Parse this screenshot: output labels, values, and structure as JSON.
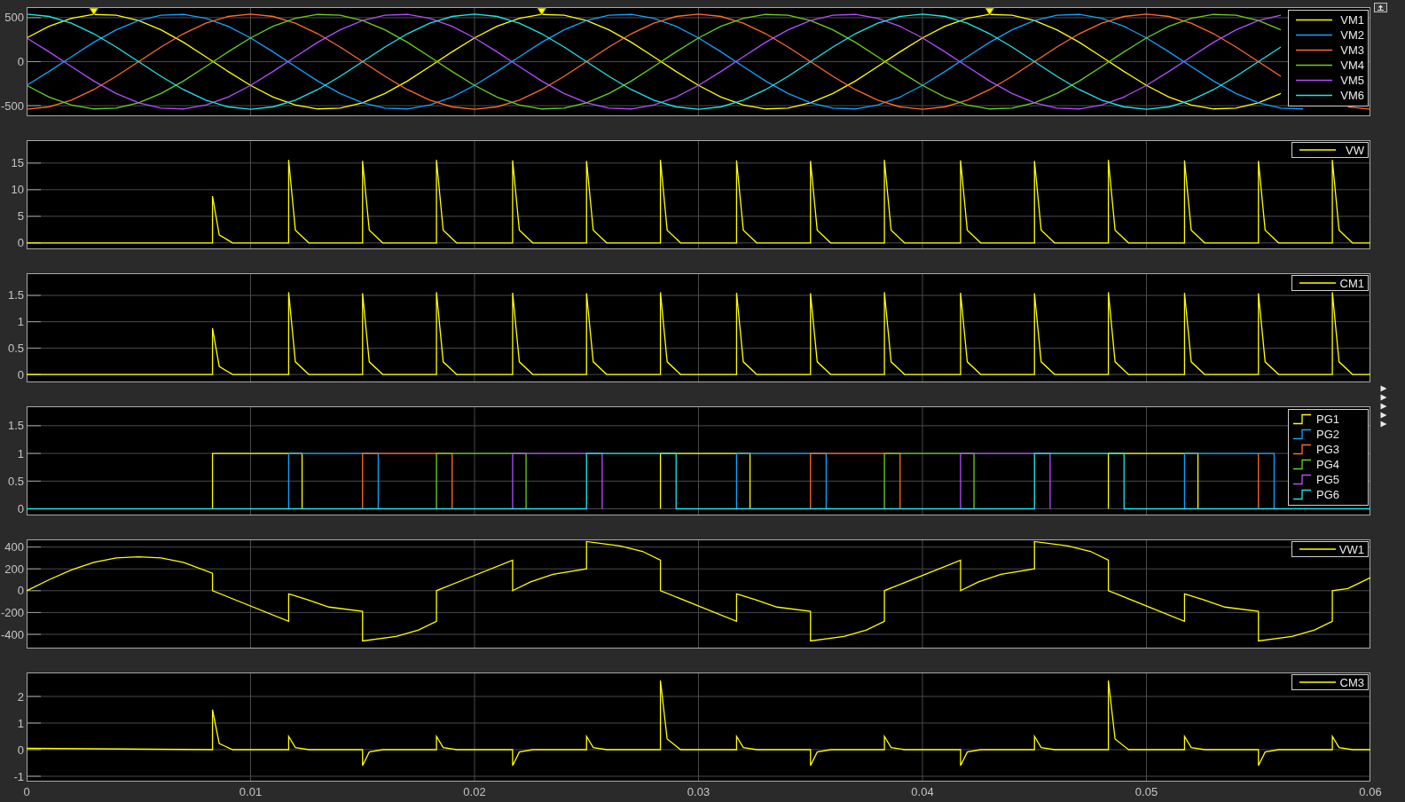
{
  "scopes": [
    {
      "peak_finder": true,
      "chart_data": {
        "type": "line",
        "grid": true,
        "legend": true,
        "xlim": [
          0,
          0.06
        ],
        "ylim": [
          -620,
          620
        ],
        "yticks": [
          -500,
          0,
          500
        ],
        "x": [
          0,
          0.001,
          0.002,
          0.003,
          0.004,
          0.005,
          0.006,
          0.007,
          0.008,
          0.009,
          0.01,
          0.011,
          0.012,
          0.013,
          0.014,
          0.015,
          0.016,
          0.017,
          0.018,
          0.019,
          0.02,
          0.021,
          0.022,
          0.023,
          0.024,
          0.025,
          0.026,
          0.027,
          0.028,
          0.029,
          0.03,
          0.031,
          0.032,
          0.033,
          0.034,
          0.035,
          0.036,
          0.037,
          0.038,
          0.039,
          0.04,
          0.041,
          0.042,
          0.043,
          0.044,
          0.045,
          0.046,
          0.047,
          0.048,
          0.049,
          0.05,
          0.051,
          0.052,
          0.053,
          0.054,
          0.055,
          0.056,
          0.057,
          0.059,
          0.06
        ],
        "series": [
          {
            "name": "VM1",
            "color": "#ffff00",
            "values": [
              270,
              401,
              493,
              537,
              528,
              468,
              361,
              220,
              56,
              -112,
              -270,
              -401,
              -493,
              -537,
              -528,
              -468,
              -361,
              -220,
              -56,
              112,
              270,
              401,
              493,
              537,
              528,
              468,
              361,
              220,
              56,
              -112,
              -270,
              -401,
              -493,
              -537,
              -528,
              -468,
              -361,
              -220,
              -56,
              112,
              270,
              401,
              493,
              537,
              528,
              468,
              361,
              220,
              56,
              -112,
              -270,
              -401,
              -493,
              -537,
              -528,
              -468,
              -361,
              null,
              null,
              null
            ]
          },
          {
            "name": "VM2",
            "color": "#0fa3ff",
            "values": [
              -270,
              -112,
              56,
              220,
              361,
              468,
              528,
              537,
              493,
              401,
              270,
              112,
              -56,
              -220,
              -361,
              -468,
              -528,
              -537,
              -493,
              -401,
              -270,
              -112,
              56,
              220,
              361,
              468,
              528,
              537,
              493,
              401,
              270,
              112,
              -56,
              -220,
              -361,
              -468,
              -528,
              -537,
              -493,
              -401,
              -270,
              -112,
              56,
              220,
              361,
              468,
              528,
              537,
              493,
              401,
              270,
              112,
              -56,
              -220,
              -361,
              -468,
              -528,
              -537,
              null,
              null
            ]
          },
          {
            "name": "VM3",
            "color": "#ff6a2b",
            "values": [
              -540,
              -514,
              -437,
              -317,
              -167,
              0,
              167,
              317,
              437,
              514,
              540,
              514,
              437,
              317,
              167,
              0,
              -167,
              -317,
              -437,
              -514,
              -540,
              -514,
              -437,
              -317,
              -167,
              0,
              167,
              317,
              437,
              514,
              540,
              514,
              437,
              317,
              167,
              0,
              -167,
              -317,
              -437,
              -514,
              -540,
              -514,
              -437,
              -317,
              -167,
              0,
              167,
              317,
              437,
              514,
              540,
              514,
              437,
              317,
              167,
              0,
              -167,
              null,
              -514,
              -540
            ]
          },
          {
            "name": "VM4",
            "color": "#69d11a",
            "values": [
              -270,
              -401,
              -493,
              -537,
              -528,
              -468,
              -361,
              -220,
              -56,
              112,
              270,
              401,
              493,
              537,
              528,
              468,
              361,
              220,
              56,
              -112,
              -270,
              -401,
              -493,
              -537,
              -528,
              -468,
              -361,
              -220,
              -56,
              112,
              270,
              401,
              493,
              537,
              528,
              468,
              361,
              220,
              56,
              -112,
              -270,
              -401,
              -493,
              -537,
              -528,
              -468,
              -361,
              -220,
              -56,
              112,
              270,
              401,
              493,
              537,
              528,
              468,
              361,
              null,
              null,
              null
            ]
          },
          {
            "name": "VM5",
            "color": "#b34dff",
            "values": [
              270,
              112,
              -56,
              -220,
              -361,
              -468,
              -528,
              -537,
              -493,
              -401,
              -270,
              -112,
              56,
              220,
              361,
              468,
              528,
              537,
              493,
              401,
              270,
              112,
              -56,
              -220,
              -361,
              -468,
              -528,
              -537,
              -493,
              -401,
              -270,
              -112,
              56,
              220,
              361,
              468,
              528,
              537,
              493,
              401,
              270,
              112,
              -56,
              -220,
              -361,
              -468,
              -528,
              -537,
              -493,
              -401,
              -270,
              -112,
              56,
              220,
              361,
              468,
              528,
              null,
              null,
              null
            ]
          },
          {
            "name": "VM6",
            "color": "#1ee6e6",
            "values": [
              540,
              514,
              437,
              317,
              167,
              0,
              -167,
              -317,
              -437,
              -514,
              -540,
              -514,
              -437,
              -317,
              -167,
              0,
              167,
              317,
              437,
              514,
              540,
              514,
              437,
              317,
              167,
              0,
              -167,
              -317,
              -437,
              -514,
              -540,
              -514,
              -437,
              -317,
              -167,
              0,
              167,
              317,
              437,
              514,
              540,
              514,
              437,
              317,
              167,
              0,
              -167,
              -317,
              -437,
              -514,
              -540,
              -514,
              -437,
              -317,
              -167,
              0,
              167,
              null,
              null,
              null
            ]
          }
        ]
      }
    },
    {
      "chart_data": {
        "type": "line",
        "grid": true,
        "legend": true,
        "xlim": [
          0,
          0.06
        ],
        "ylim": [
          -1.2,
          19.3
        ],
        "yticks": [
          0,
          5,
          10,
          15
        ],
        "x": [
          0,
          0.0083,
          0.0083,
          0.0086,
          0.0092,
          0.0117,
          0.0117,
          0.012,
          0.0126,
          0.015,
          0.015,
          0.0153,
          0.0159,
          0.0183,
          0.0183,
          0.0186,
          0.0192,
          0.0217,
          0.0217,
          0.022,
          0.0226,
          0.025,
          0.025,
          0.0253,
          0.0259,
          0.0283,
          0.0283,
          0.0286,
          0.0292,
          0.0317,
          0.0317,
          0.032,
          0.0326,
          0.035,
          0.035,
          0.0353,
          0.0359,
          0.0383,
          0.0383,
          0.0386,
          0.0392,
          0.0417,
          0.0417,
          0.042,
          0.0426,
          0.045,
          0.045,
          0.0453,
          0.0459,
          0.0483,
          0.0483,
          0.0486,
          0.0492,
          0.0517,
          0.0517,
          0.052,
          0.0526,
          0.055,
          0.055,
          0.0553,
          0.0559,
          0.0583,
          0.0583,
          0.0586,
          0.0592,
          0.06
        ],
        "series": [
          {
            "name": "VW",
            "color": "#ffff00",
            "values": [
              0,
              0,
              8.8,
              1.5,
              0,
              0,
              15.6,
              2.4,
              0,
              0,
              15.4,
              2.4,
              0,
              0,
              15.6,
              2.4,
              0,
              0,
              15.5,
              2.4,
              0,
              0,
              15.4,
              2.4,
              0,
              0,
              15.6,
              2.4,
              0,
              0,
              15.5,
              2.4,
              0,
              0,
              15.4,
              2.4,
              0,
              0,
              15.6,
              2.4,
              0,
              0,
              15.5,
              2.4,
              0,
              0,
              15.4,
              2.4,
              0,
              0,
              15.6,
              2.4,
              0,
              0,
              15.5,
              2.4,
              0,
              0,
              15.4,
              2.4,
              0,
              0,
              15.6,
              2.4,
              0,
              0
            ]
          }
        ]
      }
    },
    {
      "chart_data": {
        "type": "line",
        "grid": true,
        "legend": true,
        "xlim": [
          0,
          0.06
        ],
        "ylim": [
          -0.15,
          1.92
        ],
        "yticks": [
          0,
          0.5,
          1,
          1.5
        ],
        "x": [
          0,
          0.0083,
          0.0083,
          0.0086,
          0.0092,
          0.0117,
          0.0117,
          0.012,
          0.0126,
          0.015,
          0.015,
          0.0153,
          0.0159,
          0.0183,
          0.0183,
          0.0186,
          0.0192,
          0.0217,
          0.0217,
          0.022,
          0.0226,
          0.025,
          0.025,
          0.0253,
          0.0259,
          0.0283,
          0.0283,
          0.0286,
          0.0292,
          0.0317,
          0.0317,
          0.032,
          0.0326,
          0.035,
          0.035,
          0.0353,
          0.0359,
          0.0383,
          0.0383,
          0.0386,
          0.0392,
          0.0417,
          0.0417,
          0.042,
          0.0426,
          0.045,
          0.045,
          0.0453,
          0.0459,
          0.0483,
          0.0483,
          0.0486,
          0.0492,
          0.0517,
          0.0517,
          0.052,
          0.0526,
          0.055,
          0.055,
          0.0553,
          0.0559,
          0.0583,
          0.0583,
          0.0586,
          0.0592,
          0.06
        ],
        "series": [
          {
            "name": "CM1",
            "color": "#ffff00",
            "values": [
              0,
              0,
              0.88,
              0.15,
              0,
              0,
              1.56,
              0.24,
              0,
              0,
              1.54,
              0.24,
              0,
              0,
              1.56,
              0.24,
              0,
              0,
              1.55,
              0.24,
              0,
              0,
              1.54,
              0.24,
              0,
              0,
              1.56,
              0.24,
              0,
              0,
              1.55,
              0.24,
              0,
              0,
              1.54,
              0.24,
              0,
              0,
              1.56,
              0.24,
              0,
              0,
              1.55,
              0.24,
              0,
              0,
              1.54,
              0.24,
              0,
              0,
              1.56,
              0.24,
              0,
              0,
              1.55,
              0.24,
              0,
              0,
              1.54,
              0.24,
              0,
              0,
              1.56,
              0.24,
              0,
              0
            ]
          }
        ]
      }
    },
    {
      "chart_data": {
        "type": "line",
        "grid": true,
        "legend": true,
        "xlim": [
          0,
          0.06
        ],
        "ylim": [
          -0.12,
          1.85
        ],
        "yticks": [
          0,
          0.5,
          1,
          1.5
        ],
        "x": [
          0,
          0.0083,
          0.0083,
          0.0117,
          0.0117,
          0.0123,
          0.0123,
          0.015,
          0.015,
          0.0157,
          0.0157,
          0.0183,
          0.0183,
          0.019,
          0.019,
          0.0217,
          0.0217,
          0.0223,
          0.0223,
          0.025,
          0.025,
          0.0257,
          0.0257,
          0.0283,
          0.0283,
          0.029,
          0.029,
          0.0317,
          0.0317,
          0.0323,
          0.0323,
          0.035,
          0.035,
          0.0357,
          0.0357,
          0.0383,
          0.0383,
          0.039,
          0.039,
          0.0417,
          0.0417,
          0.0423,
          0.0423,
          0.045,
          0.045,
          0.0457,
          0.0457,
          0.0483,
          0.0483,
          0.049,
          0.049,
          0.0517,
          0.0517,
          0.0523,
          0.0523,
          0.055,
          0.055,
          0.0557,
          0.0557,
          0.0583,
          0.0583,
          0.059,
          0.059,
          0.06
        ],
        "series": [
          {
            "name": "PG1",
            "color": "#ffff00",
            "values": [
              null,
              0,
              1,
              1,
              1,
              1,
              0,
              null,
              null,
              null,
              null,
              null,
              null,
              null,
              null,
              null,
              null,
              null,
              null,
              null,
              null,
              null,
              null,
              0,
              1,
              1,
              1,
              1,
              1,
              1,
              0,
              null,
              null,
              null,
              null,
              null,
              null,
              null,
              null,
              null,
              null,
              null,
              null,
              null,
              null,
              null,
              null,
              0,
              1,
              1,
              1,
              1,
              1,
              1,
              0,
              null,
              null,
              null,
              null,
              null,
              null,
              null,
              null,
              null
            ]
          },
          {
            "name": "PG2",
            "color": "#0fa3ff",
            "values": [
              null,
              null,
              null,
              0,
              1,
              1,
              1,
              1,
              1,
              1,
              0,
              null,
              null,
              null,
              null,
              null,
              null,
              null,
              null,
              null,
              null,
              null,
              null,
              null,
              null,
              null,
              null,
              0,
              1,
              1,
              1,
              1,
              1,
              1,
              0,
              null,
              null,
              null,
              null,
              null,
              null,
              null,
              null,
              null,
              null,
              null,
              null,
              null,
              null,
              null,
              null,
              0,
              1,
              1,
              1,
              1,
              1,
              1,
              0,
              null,
              null,
              null,
              null,
              null
            ]
          },
          {
            "name": "PG3",
            "color": "#ff6a2b",
            "values": [
              null,
              null,
              null,
              null,
              null,
              null,
              null,
              0,
              1,
              1,
              1,
              1,
              1,
              1,
              0,
              null,
              null,
              null,
              null,
              null,
              null,
              null,
              null,
              null,
              null,
              null,
              null,
              null,
              null,
              null,
              null,
              0,
              1,
              1,
              1,
              1,
              1,
              1,
              0,
              null,
              null,
              null,
              null,
              null,
              null,
              null,
              null,
              null,
              null,
              null,
              null,
              null,
              null,
              null,
              null,
              0,
              1,
              null,
              null,
              null,
              null,
              null,
              null,
              null
            ]
          },
          {
            "name": "PG4",
            "color": "#69d11a",
            "values": [
              null,
              null,
              null,
              null,
              null,
              null,
              null,
              null,
              null,
              null,
              null,
              0,
              1,
              1,
              1,
              1,
              1,
              1,
              0,
              null,
              null,
              null,
              null,
              null,
              null,
              null,
              null,
              null,
              null,
              null,
              null,
              null,
              null,
              null,
              null,
              0,
              1,
              1,
              1,
              1,
              1,
              1,
              0,
              null,
              null,
              null,
              null,
              null,
              null,
              null,
              null,
              null,
              null,
              null,
              null,
              null,
              null,
              null,
              null,
              null,
              null,
              null,
              null,
              null
            ]
          },
          {
            "name": "PG5",
            "color": "#b34dff",
            "values": [
              null,
              null,
              null,
              null,
              null,
              null,
              null,
              null,
              null,
              null,
              null,
              null,
              null,
              null,
              null,
              0,
              1,
              1,
              1,
              1,
              1,
              1,
              0,
              null,
              null,
              null,
              null,
              null,
              null,
              null,
              null,
              null,
              null,
              null,
              null,
              null,
              null,
              null,
              null,
              0,
              1,
              1,
              1,
              1,
              1,
              1,
              0,
              null,
              null,
              null,
              null,
              null,
              null,
              null,
              null,
              null,
              null,
              null,
              null,
              null,
              null,
              null,
              null,
              null
            ]
          },
          {
            "name": "PG6",
            "color": "#1ee6e6",
            "values": [
              0,
              0,
              0,
              0,
              0,
              0,
              0,
              0,
              0,
              0,
              0,
              0,
              0,
              0,
              0,
              0,
              0,
              0,
              0,
              0,
              1,
              1,
              1,
              1,
              1,
              1,
              0,
              0,
              0,
              0,
              0,
              0,
              0,
              0,
              0,
              0,
              0,
              0,
              0,
              0,
              0,
              0,
              0,
              0,
              1,
              1,
              1,
              1,
              1,
              1,
              0,
              0,
              0,
              0,
              0,
              0,
              0,
              0,
              0,
              0,
              0,
              0,
              0,
              0
            ]
          }
        ]
      }
    },
    {
      "chart_data": {
        "type": "line",
        "grid": true,
        "legend": true,
        "xlim": [
          0,
          0.06
        ],
        "ylim": [
          -530,
          470
        ],
        "yticks": [
          -400,
          -200,
          0,
          200,
          400
        ],
        "x": [
          0,
          0.001,
          0.002,
          0.003,
          0.004,
          0.005,
          0.006,
          0.007,
          0.0083,
          0.0083,
          0.0117,
          0.0117,
          0.0125,
          0.0135,
          0.015,
          0.015,
          0.0165,
          0.0175,
          0.0183,
          0.0183,
          0.0217,
          0.0217,
          0.0225,
          0.0235,
          0.025,
          0.025,
          0.0265,
          0.0275,
          0.0283,
          0.0283,
          0.0317,
          0.0317,
          0.0325,
          0.0335,
          0.035,
          0.035,
          0.0365,
          0.0375,
          0.0383,
          0.0383,
          0.0417,
          0.0417,
          0.0425,
          0.0435,
          0.045,
          0.045,
          0.0465,
          0.0475,
          0.0483,
          0.0483,
          0.0517,
          0.0517,
          0.0525,
          0.0535,
          0.055,
          0.055,
          0.0565,
          0.0575,
          0.0583,
          0.0583,
          0.059,
          0.06
        ],
        "series": [
          {
            "name": "VW1",
            "color": "#ffff00",
            "values": [
              0,
              100,
              190,
              260,
              300,
              310,
              300,
              260,
              160,
              0,
              -280,
              -30,
              -80,
              -150,
              -190,
              -460,
              -420,
              -360,
              -280,
              0,
              280,
              0,
              80,
              150,
              200,
              450,
              410,
              360,
              280,
              0,
              -280,
              -30,
              -80,
              -150,
              -190,
              -460,
              -420,
              -360,
              -280,
              0,
              280,
              0,
              80,
              150,
              200,
              450,
              410,
              360,
              280,
              0,
              -280,
              -30,
              -80,
              -150,
              -190,
              -460,
              -420,
              -360,
              -280,
              0,
              20,
              120
            ]
          }
        ]
      }
    },
    {
      "chart_data": {
        "type": "line",
        "grid": true,
        "legend": true,
        "xlim": [
          0,
          0.06
        ],
        "ylim": [
          -1.2,
          2.9
        ],
        "xticks": [
          0,
          0.01,
          0.02,
          0.03,
          0.04,
          0.05,
          0.06
        ],
        "yticks": [
          -1,
          0,
          1,
          2
        ],
        "x": [
          0,
          0.0083,
          0.0083,
          0.0086,
          0.0092,
          0.0117,
          0.0117,
          0.012,
          0.0126,
          0.015,
          0.015,
          0.0153,
          0.0159,
          0.0183,
          0.0183,
          0.0186,
          0.0192,
          0.0217,
          0.0217,
          0.022,
          0.0226,
          0.025,
          0.025,
          0.0253,
          0.0259,
          0.0283,
          0.0283,
          0.0286,
          0.0292,
          0.0317,
          0.0317,
          0.032,
          0.0326,
          0.035,
          0.035,
          0.0353,
          0.0359,
          0.0383,
          0.0383,
          0.0386,
          0.0392,
          0.0417,
          0.0417,
          0.042,
          0.0426,
          0.045,
          0.045,
          0.0453,
          0.0459,
          0.0483,
          0.0483,
          0.0486,
          0.0492,
          0.0517,
          0.0517,
          0.052,
          0.0526,
          0.055,
          0.055,
          0.0553,
          0.0559,
          0.0583,
          0.0583,
          0.0586,
          0.0592,
          0.06
        ],
        "series": [
          {
            "name": "CM3",
            "color": "#ffff00",
            "values": [
              0.05,
              0,
              1.5,
              0.23,
              0,
              0,
              0.5,
              0.08,
              0,
              0,
              -0.6,
              -0.09,
              0,
              0,
              0.5,
              0.08,
              0,
              0,
              -0.6,
              -0.09,
              0,
              0,
              0.5,
              0.08,
              0,
              0,
              2.6,
              0.4,
              0,
              0,
              0.5,
              0.08,
              0,
              0,
              -0.6,
              -0.09,
              0,
              0,
              0.5,
              0.08,
              0,
              0,
              -0.6,
              -0.09,
              0,
              0,
              0.5,
              0.08,
              0,
              0,
              2.6,
              0.4,
              0,
              0,
              0.5,
              0.08,
              0,
              0,
              -0.6,
              -0.09,
              0,
              0,
              0.5,
              0.08,
              0,
              0
            ]
          }
        ]
      }
    }
  ]
}
